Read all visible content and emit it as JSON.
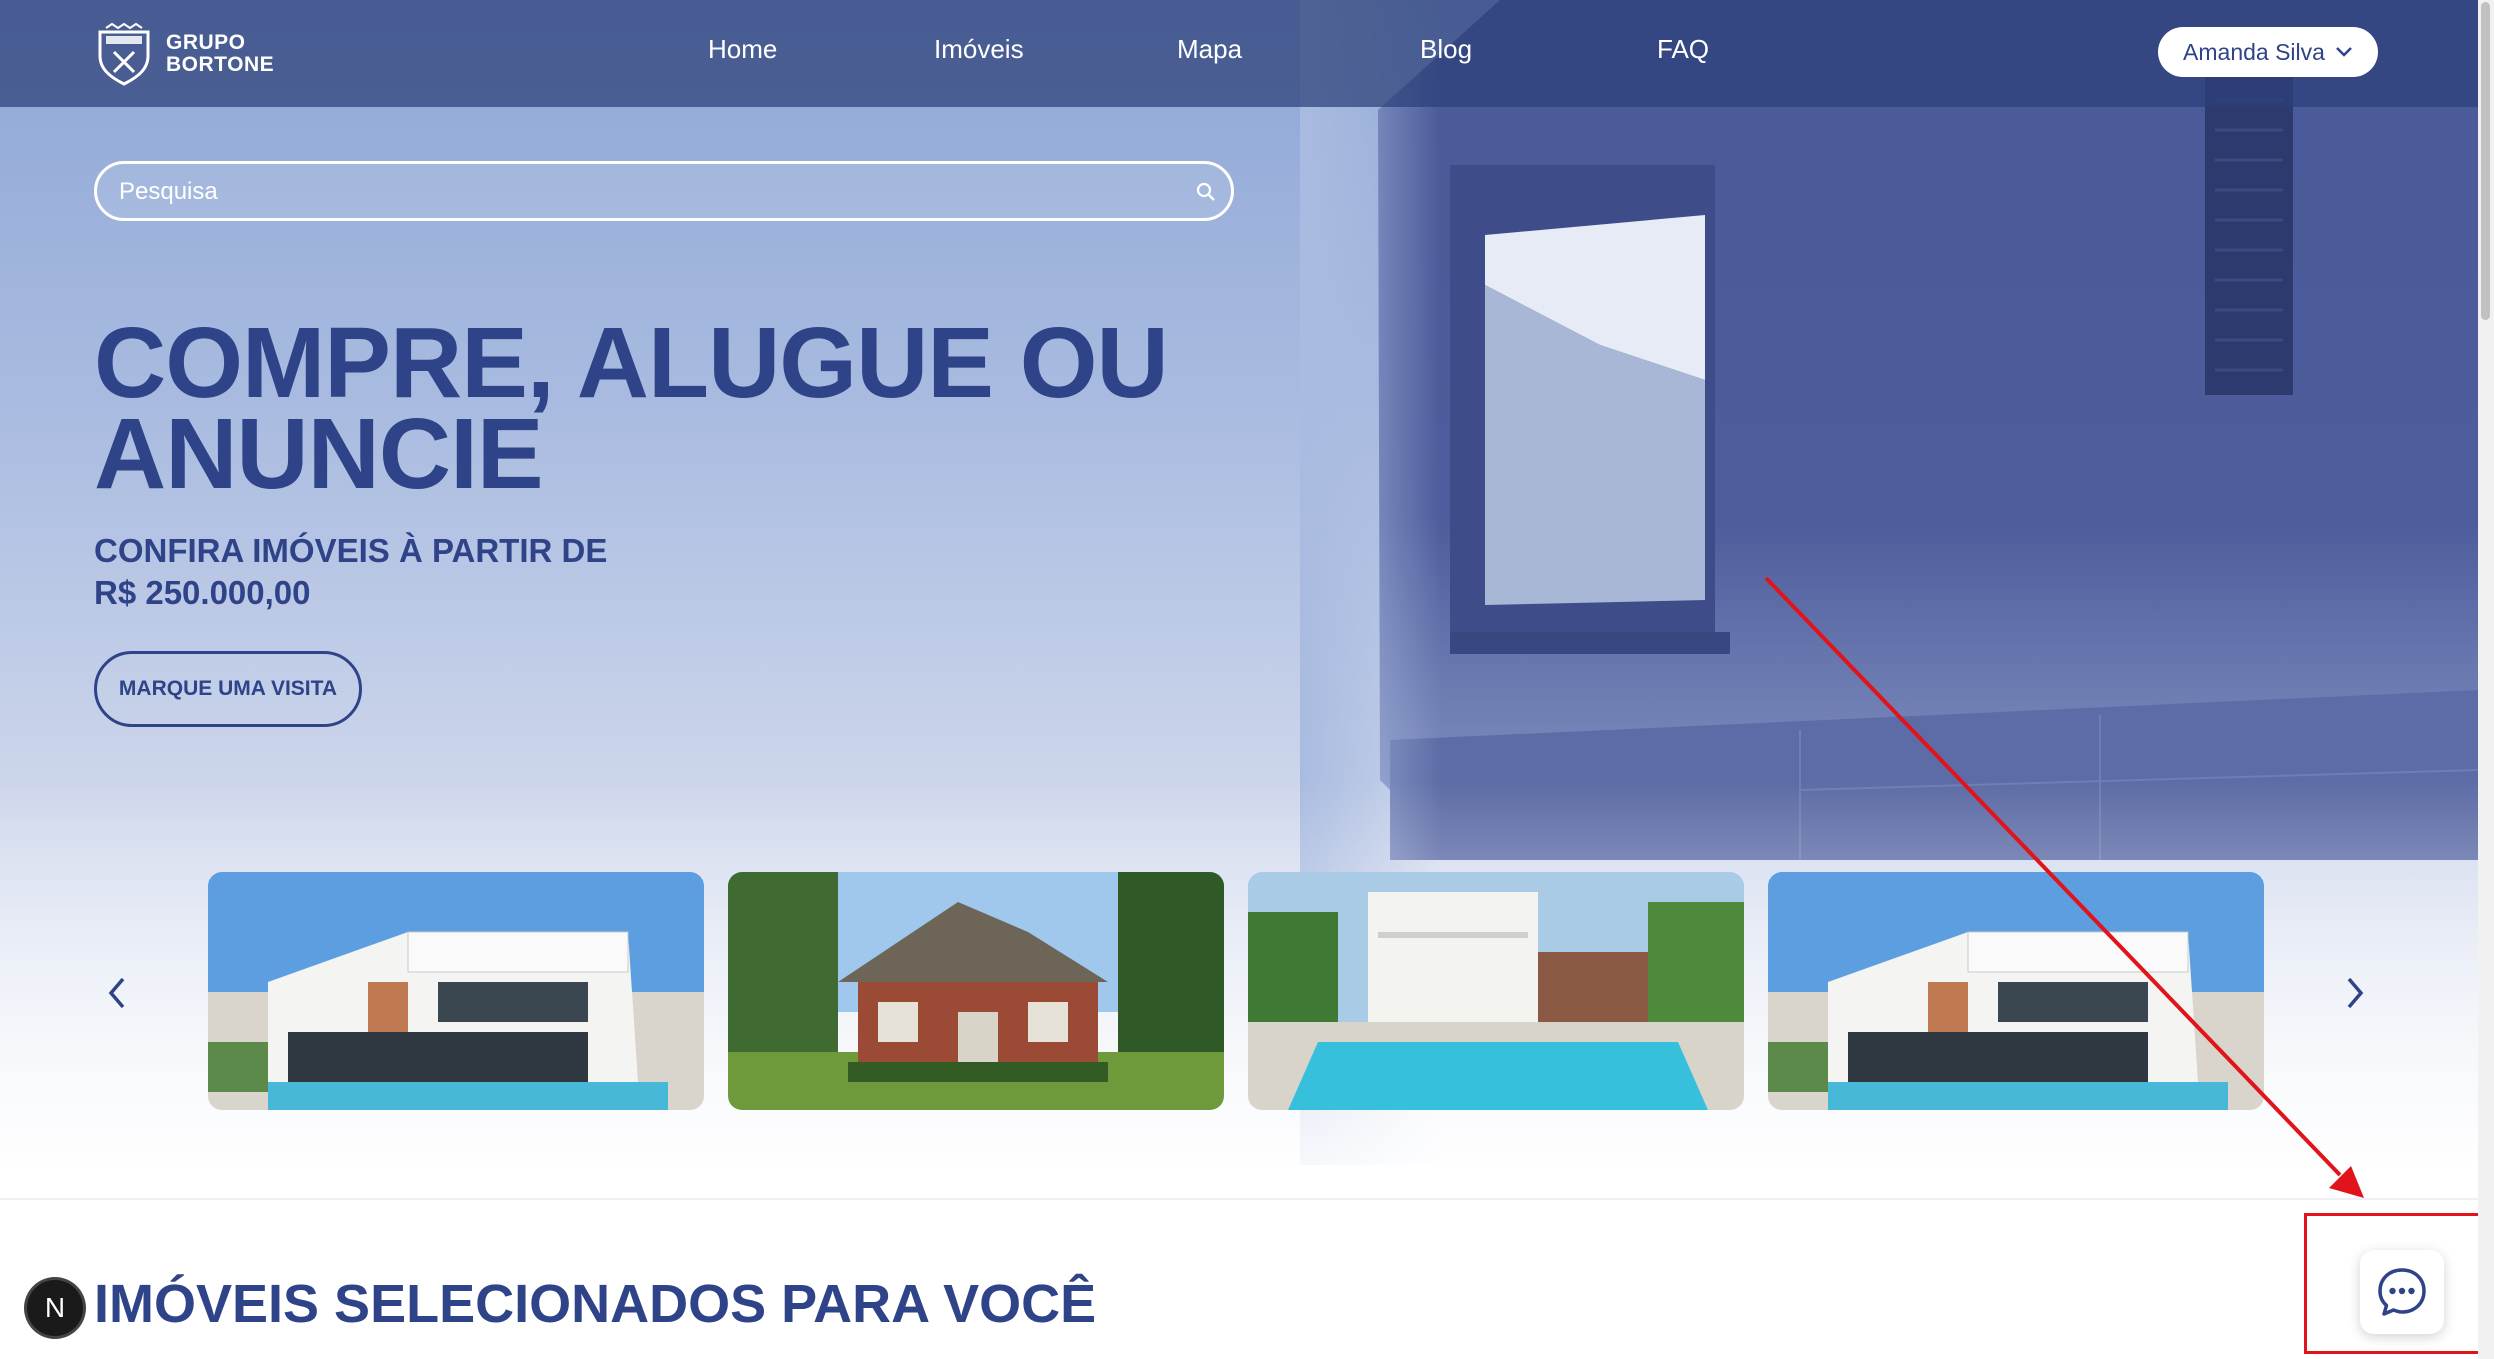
{
  "header": {
    "logo_line1": "GRUPO",
    "logo_line2": "BORTONE",
    "nav": [
      "Home",
      "Imóveis",
      "Mapa",
      "Blog",
      "FAQ"
    ],
    "user_name": "Amanda Silva"
  },
  "hero": {
    "search_placeholder": "Pesquisa",
    "headline_line1": "COMPRE, ALUGUE OU",
    "headline_line2": "ANUNCIE",
    "subline_line1": "CONFIRA IMÓVEIS À PARTIR DE",
    "subline_line2": "R$ 250.000,00",
    "cta_label": "MARQUE UMA VISITA"
  },
  "carousel": {
    "items": [
      "modern-house",
      "brick-house",
      "pool-house",
      "modern-house"
    ]
  },
  "section": {
    "title": "IMÓVEIS SELECIONADOS PARA VOCÊ"
  },
  "badge": {
    "letter": "N"
  },
  "colors": {
    "brand": "#2f4388",
    "annotation": "#e0141a"
  }
}
